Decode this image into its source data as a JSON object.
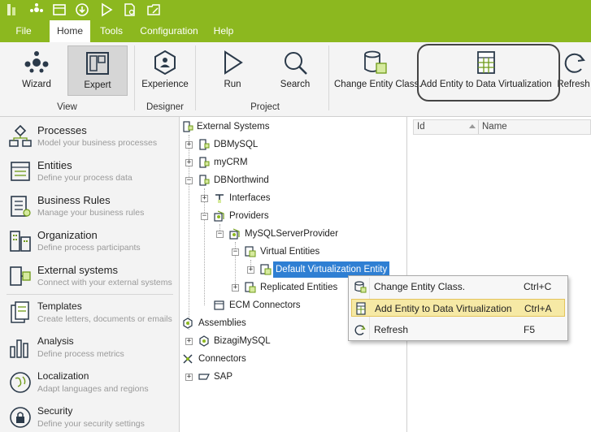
{
  "menubar": {
    "tabs": [
      {
        "label": "File",
        "active": false
      },
      {
        "label": "Home",
        "active": true
      },
      {
        "label": "Tools",
        "active": false
      },
      {
        "label": "Configuration",
        "active": false
      },
      {
        "label": "Help",
        "active": false
      }
    ]
  },
  "ribbon": {
    "buttons": {
      "wizard": "Wizard",
      "expert": "Expert",
      "experience": "Experience",
      "run": "Run",
      "search": "Search",
      "change_entity_class": "Change Entity Class.",
      "add_entity": "Add Entity to Data Virtualization",
      "refresh": "Refresh"
    },
    "groups": {
      "view": "View",
      "designer": "Designer",
      "project": "Project"
    }
  },
  "leftnav": {
    "items": [
      {
        "title": "Processes",
        "desc": "Model your business processes"
      },
      {
        "title": "Entities",
        "desc": "Define your process data"
      },
      {
        "title": "Business Rules",
        "desc": "Manage your business rules"
      },
      {
        "title": "Organization",
        "desc": "Define process participants"
      },
      {
        "title": "External systems",
        "desc": "Connect with your external systems"
      },
      {
        "title": "Templates",
        "desc": "Create letters, documents  or emails"
      },
      {
        "title": "Analysis",
        "desc": "Define process metrics"
      },
      {
        "title": "Localization",
        "desc": "Adapt languages and regions"
      },
      {
        "title": "Security",
        "desc": "Define your security settings"
      }
    ]
  },
  "tree": {
    "external_systems": "External Systems",
    "dbmysql": "DBMySQL",
    "mycrm": "myCRM",
    "dbnorthwind": "DBNorthwind",
    "interfaces": "Interfaces",
    "providers": "Providers",
    "mysqlserverprovider": "MySQLServerProvider",
    "virtual_entities": "Virtual Entities",
    "default_virtualization_entity": "Default Virtualization Entity",
    "replicated_entities": "Replicated Entities",
    "ecm_connectors": "ECM Connectors",
    "assemblies": "Assemblies",
    "bizagimysql": "BizagiMySQL",
    "connectors": "Connectors",
    "sap": "SAP"
  },
  "grid": {
    "columns": [
      "Id",
      "Name"
    ]
  },
  "context_menu": {
    "items": [
      {
        "label": "Change Entity Class.",
        "shortcut": "Ctrl+C",
        "icon": "database-icon"
      },
      {
        "label": "Add Entity to Data Virtualization",
        "shortcut": "Ctrl+A",
        "icon": "table-icon"
      },
      {
        "label": "Refresh",
        "shortcut": "F5",
        "icon": "refresh-icon"
      }
    ]
  },
  "colors": {
    "accent": "#8cb81f",
    "selection": "#2f7fd3",
    "menu_hover": "#f6e9a5"
  }
}
